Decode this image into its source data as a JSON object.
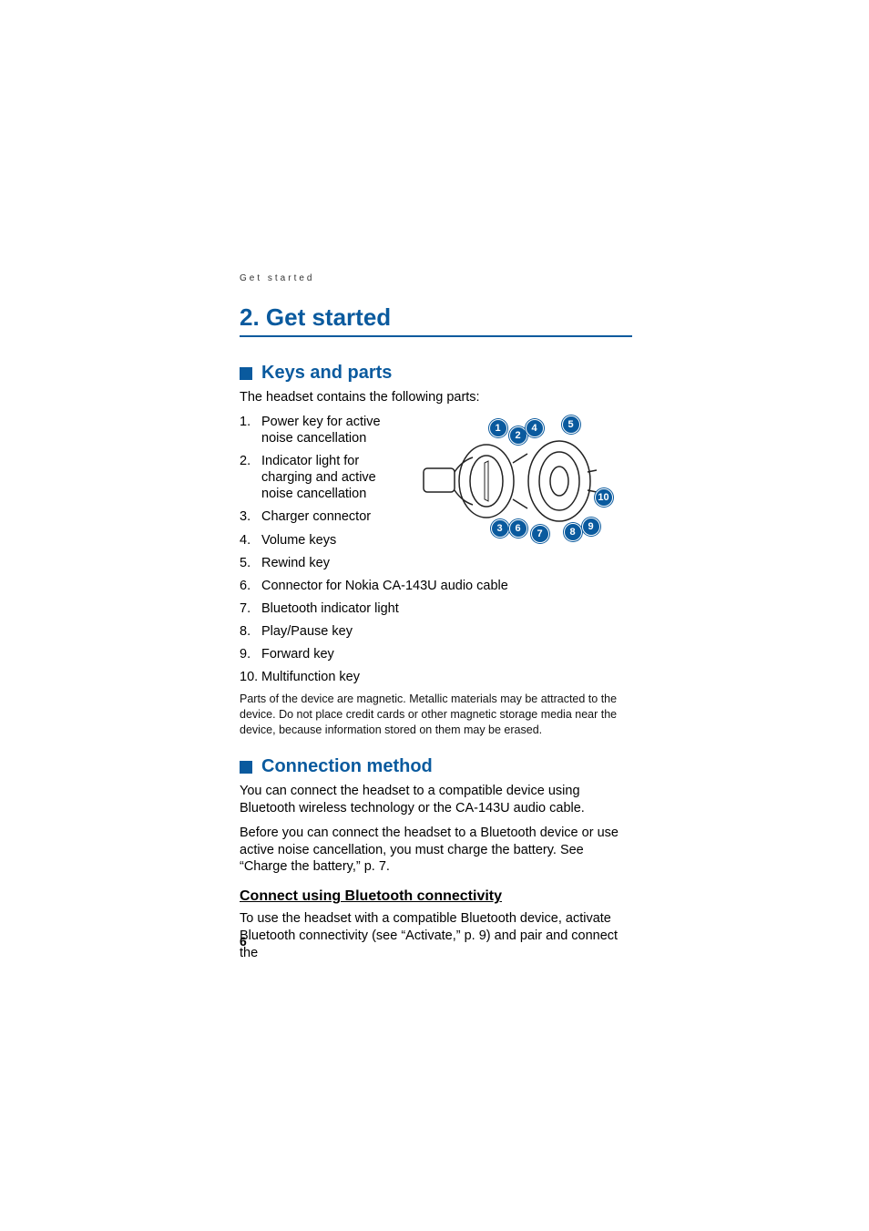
{
  "header": "Get started",
  "chapter": "2.   Get started",
  "section1": {
    "title": "Keys and parts",
    "intro": "The headset contains the following parts:",
    "parts": [
      "Power key for active noise cancellation",
      "Indicator light for charging and active noise cancellation",
      "Charger connector",
      "Volume keys",
      "Rewind key",
      "Connector for Nokia CA-143U audio cable",
      "Bluetooth indicator light",
      "Play/Pause key",
      "Forward key",
      "Multifunction key"
    ],
    "note": "Parts of the device are magnetic. Metallic materials may be attracted to the device. Do not place credit cards or other magnetic storage media near the device, because information stored on them may be erased."
  },
  "section2": {
    "title": "Connection method",
    "para1": "You can connect the headset to a compatible device using Bluetooth wireless technology or the CA-143U audio cable.",
    "para2": "Before you can connect the headset to a Bluetooth device or use active noise cancellation, you must charge the battery. See “Charge the battery,” p. 7.",
    "sub1": {
      "title": "Connect using Bluetooth connectivity",
      "para": "To use the headset with a compatible Bluetooth device, activate Bluetooth connectivity (see “Activate,” p. 9) and pair and connect the"
    }
  },
  "callouts": [
    "1",
    "2",
    "3",
    "4",
    "5",
    "6",
    "7",
    "8",
    "9",
    "10"
  ],
  "pageNumber": "6"
}
